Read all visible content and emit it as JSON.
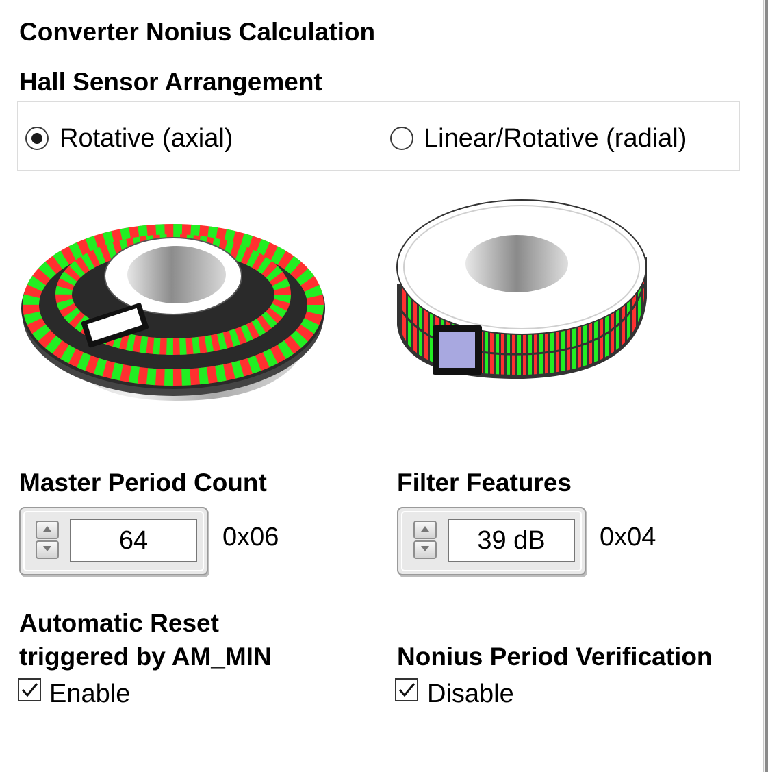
{
  "page_title": "Converter Nonius Calculation",
  "hall_sensor": {
    "heading": "Hall Sensor Arrangement",
    "options": [
      {
        "label": "Rotative (axial)",
        "selected": true
      },
      {
        "label": "Linear/Rotative (radial)",
        "selected": false
      }
    ]
  },
  "master_period": {
    "heading": "Master Period Count",
    "value": "64",
    "hex": "0x06"
  },
  "filter_features": {
    "heading": "Filter Features",
    "value": "39 dB",
    "hex": "0x04"
  },
  "auto_reset": {
    "heading_line1": "Automatic Reset",
    "heading_line2": "triggered by AM_MIN",
    "checkbox_label": "Enable",
    "checked": true
  },
  "nonius_verification": {
    "heading": "Nonius Period Verification",
    "checkbox_label": "Disable",
    "checked": true
  },
  "colors": {
    "stripe_red": "#ff3030",
    "stripe_green": "#22ee22",
    "chip_blue": "#a8a8e0",
    "radio_dot": "#1a1a1a"
  }
}
